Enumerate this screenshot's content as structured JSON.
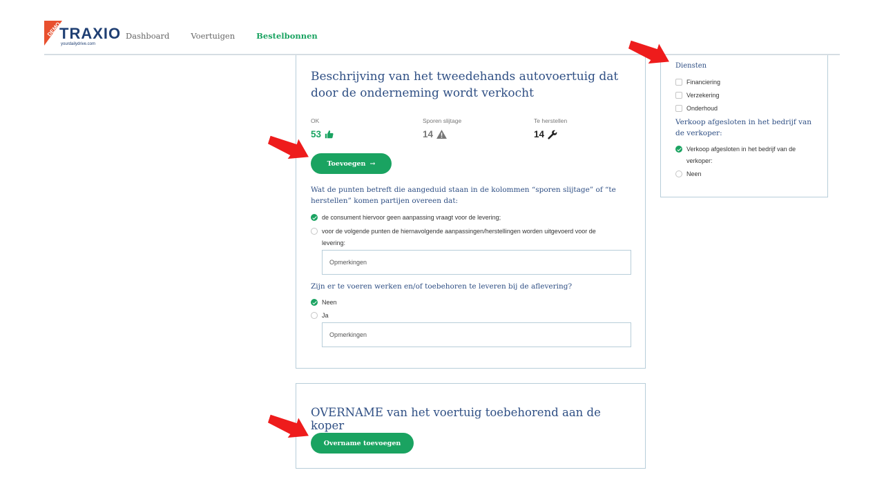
{
  "header": {
    "logo_text": "TRAXIO",
    "logo_badge": "DEMO",
    "logo_sub": "yourdailydrive.com",
    "nav": [
      {
        "label": "Dashboard",
        "active": false
      },
      {
        "label": "Voertuigen",
        "active": false
      },
      {
        "label": "Bestelbonnen",
        "active": true
      }
    ]
  },
  "main": {
    "title": "Beschrijving van het tweedehands autovoertuig dat door de onderneming wordt verkocht",
    "stats": [
      {
        "label": "OK",
        "value": "53",
        "icon": "thumbs-up-icon"
      },
      {
        "label": "Sporen slijtage",
        "value": "14",
        "icon": "warning-icon"
      },
      {
        "label": "Te herstellen",
        "value": "14",
        "icon": "wrench-icon"
      }
    ],
    "add_button": "Toevoegen",
    "question1": "Wat de punten betreft die aangeduid staan in de kolommen “sporen slijtage” of “te herstellen” komen partijen overeen dat:",
    "q1_options": [
      {
        "label": "de consument hiervoor geen aanpassing vraagt voor de levering;",
        "checked": true
      },
      {
        "label": "voor de volgende punten de hiernavolgende aanpassingen/herstellingen worden uitgevoerd voor de levering:",
        "checked": false
      }
    ],
    "remarks1_placeholder": "Opmerkingen",
    "question2": "Zijn er te voeren werken en/of toebehoren te leveren bij de aflevering?",
    "q2_options": [
      {
        "label": "Neen",
        "checked": true
      },
      {
        "label": "Ja",
        "checked": false
      }
    ],
    "remarks2_placeholder": "Opmerkingen"
  },
  "sidebar": {
    "title": "Diensten",
    "services": [
      {
        "label": "Financiering",
        "checked": false
      },
      {
        "label": "Verzekering",
        "checked": false
      },
      {
        "label": "Onderhoud",
        "checked": false
      }
    ],
    "question": "Verkoop afgesloten in het bedrijf van de verkoper:",
    "options": [
      {
        "label": "Verkoop afgesloten in het bedrijf van de verkoper:",
        "checked": true
      },
      {
        "label": "Neen",
        "checked": false
      }
    ]
  },
  "overname": {
    "title": "OVERNAME van het voertuig toebehorend aan de koper",
    "button": "Overname toevoegen"
  },
  "colors": {
    "accent_green": "#1aa361",
    "heading_blue": "#2f4f84",
    "border": "#b7cdd9",
    "arrow_red": "#ee1c1c"
  }
}
